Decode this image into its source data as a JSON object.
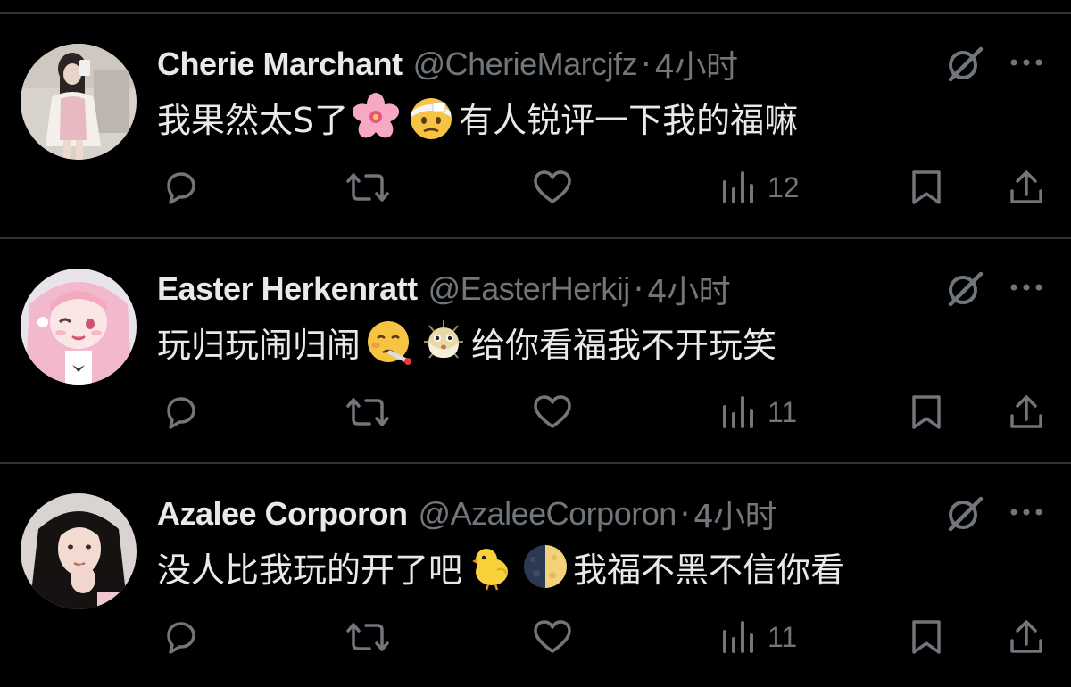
{
  "theme": {
    "background": "#000000",
    "text_primary": "#e7e9ea",
    "text_secondary": "#71767b",
    "divider": "#2f3336"
  },
  "tweets": [
    {
      "name": "Cherie Marchant",
      "handle": "@CherieMarcjfz",
      "separator": "·",
      "time": "4小时",
      "text_before": "我果然太S了",
      "emojis": [
        "cherry-blossom-emoji",
        "face-with-head-bandage-emoji"
      ],
      "text_after": "有人锐评一下我的福嘛",
      "views": "12",
      "icons": [
        "reply-icon",
        "retweet-icon",
        "like-icon",
        "views-icon",
        "bookmark-icon",
        "share-icon"
      ]
    },
    {
      "name": "Easter Herkenratt",
      "handle": "@EasterHerkij",
      "separator": "·",
      "time": "4小时",
      "text_before": "玩归玩闹归闹",
      "emojis": [
        "face-with-thermometer-emoji",
        "blowfish-emoji"
      ],
      "text_after": "给你看福我不开玩笑",
      "views": "11",
      "icons": [
        "reply-icon",
        "retweet-icon",
        "like-icon",
        "views-icon",
        "bookmark-icon",
        "share-icon"
      ]
    },
    {
      "name": "Azalee Corporon",
      "handle": "@AzaleeCorporon",
      "separator": "·",
      "time": "4小时",
      "text_before": "没人比我玩的开了吧",
      "emojis": [
        "baby-chick-emoji",
        "last-quarter-moon-emoji"
      ],
      "text_after": "我福不黑不信你看",
      "views": "11",
      "icons": [
        "reply-icon",
        "retweet-icon",
        "like-icon",
        "views-icon",
        "bookmark-icon",
        "share-icon"
      ]
    }
  ]
}
